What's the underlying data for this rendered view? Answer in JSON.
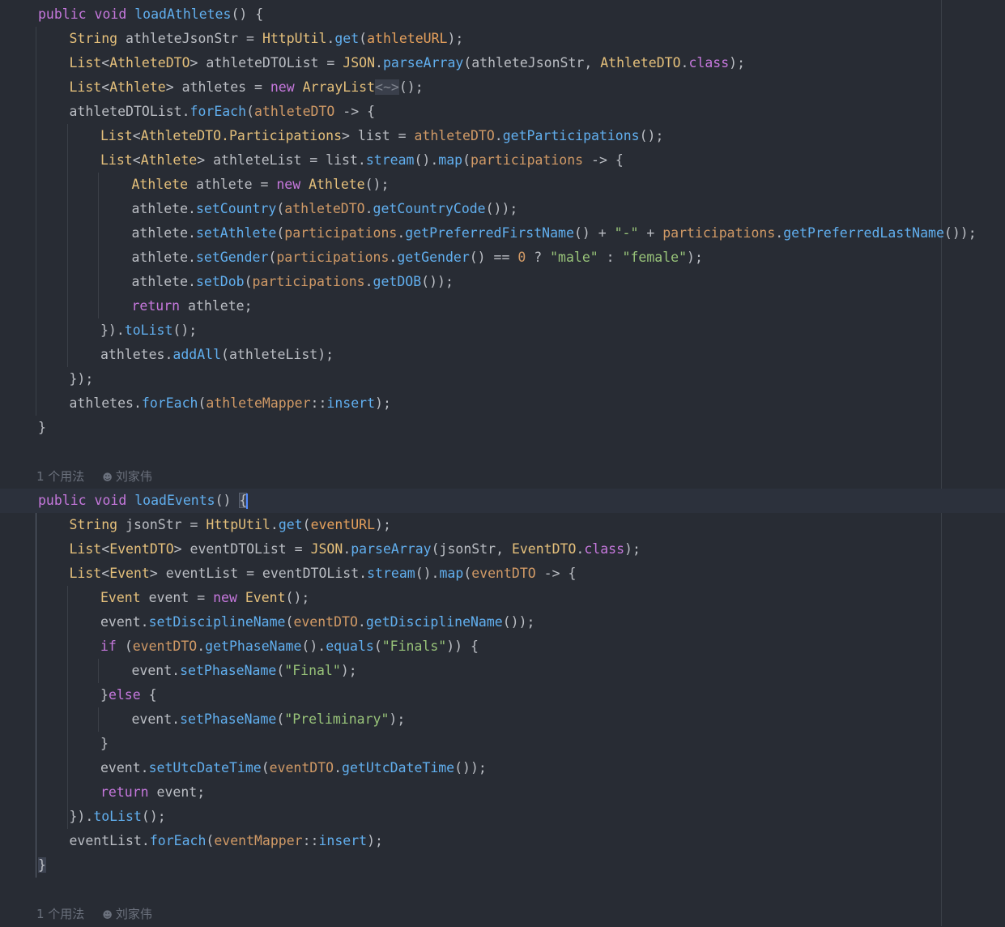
{
  "theme": {
    "background": "#282c34",
    "keyword": "#c678dd",
    "type": "#e5c07b",
    "method": "#61afef",
    "string": "#98c379",
    "field": "#e5a05c"
  },
  "hints": [
    {
      "usages": "1 个用法",
      "author": "刘家伟"
    },
    {
      "usages": "1 个用法",
      "author": "刘家伟"
    }
  ],
  "code": [
    {
      "indent": 0,
      "tokens": [
        [
          "kw",
          "public "
        ],
        [
          "kw",
          "void "
        ],
        [
          "fn",
          "loadAthletes"
        ],
        [
          "pl",
          "() {"
        ]
      ]
    },
    {
      "indent": 1,
      "tokens": [
        [
          "ty",
          "String "
        ],
        [
          "pl",
          "athleteJsonStr = "
        ],
        [
          "ty",
          "HttpUtil"
        ],
        [
          "pl",
          "."
        ],
        [
          "fn",
          "get"
        ],
        [
          "pl",
          "("
        ],
        [
          "fld",
          "athleteURL"
        ],
        [
          "pl",
          ");"
        ]
      ]
    },
    {
      "indent": 1,
      "tokens": [
        [
          "ty",
          "List"
        ],
        [
          "pl",
          "<"
        ],
        [
          "ty",
          "AthleteDTO"
        ],
        [
          "pl",
          "> athleteDTOList = "
        ],
        [
          "ty",
          "JSON"
        ],
        [
          "pl",
          "."
        ],
        [
          "fn",
          "parseArray"
        ],
        [
          "pl",
          "(athleteJsonStr, "
        ],
        [
          "ty",
          "AthleteDTO"
        ],
        [
          "pl",
          "."
        ],
        [
          "cls",
          "class"
        ],
        [
          "pl",
          ");"
        ]
      ]
    },
    {
      "indent": 1,
      "tokens": [
        [
          "ty",
          "List"
        ],
        [
          "pl",
          "<"
        ],
        [
          "ty",
          "Athlete"
        ],
        [
          "pl",
          "> athletes = "
        ],
        [
          "kw",
          "new "
        ],
        [
          "ty",
          "ArrayList"
        ],
        [
          "fold",
          "<~>"
        ],
        [
          "pl",
          "();"
        ]
      ]
    },
    {
      "indent": 1,
      "tokens": [
        [
          "pl",
          "athleteDTOList."
        ],
        [
          "fn",
          "forEach"
        ],
        [
          "pl",
          "("
        ],
        [
          "lam",
          "athleteDTO"
        ],
        [
          "pl",
          " -> {"
        ]
      ]
    },
    {
      "indent": 2,
      "tokens": [
        [
          "ty",
          "List"
        ],
        [
          "pl",
          "<"
        ],
        [
          "ty",
          "AthleteDTO.Participations"
        ],
        [
          "pl",
          "> list = "
        ],
        [
          "lam",
          "athleteDTO"
        ],
        [
          "pl",
          "."
        ],
        [
          "fn",
          "getParticipations"
        ],
        [
          "pl",
          "();"
        ]
      ]
    },
    {
      "indent": 2,
      "tokens": [
        [
          "ty",
          "List"
        ],
        [
          "pl",
          "<"
        ],
        [
          "ty",
          "Athlete"
        ],
        [
          "pl",
          "> athleteList = list."
        ],
        [
          "fn",
          "stream"
        ],
        [
          "pl",
          "()."
        ],
        [
          "fn",
          "map"
        ],
        [
          "pl",
          "("
        ],
        [
          "lam",
          "participations"
        ],
        [
          "pl",
          " -> {"
        ]
      ]
    },
    {
      "indent": 3,
      "tokens": [
        [
          "ty",
          "Athlete "
        ],
        [
          "pl",
          "athlete = "
        ],
        [
          "kw",
          "new "
        ],
        [
          "ty",
          "Athlete"
        ],
        [
          "pl",
          "();"
        ]
      ]
    },
    {
      "indent": 3,
      "tokens": [
        [
          "pl",
          "athlete."
        ],
        [
          "fn",
          "setCountry"
        ],
        [
          "pl",
          "("
        ],
        [
          "lam",
          "athleteDTO"
        ],
        [
          "pl",
          "."
        ],
        [
          "fn",
          "getCountryCode"
        ],
        [
          "pl",
          "());"
        ]
      ]
    },
    {
      "indent": 3,
      "tokens": [
        [
          "pl",
          "athlete."
        ],
        [
          "fn",
          "setAthlete"
        ],
        [
          "pl",
          "("
        ],
        [
          "lam",
          "participations"
        ],
        [
          "pl",
          "."
        ],
        [
          "fn",
          "getPreferredFirstName"
        ],
        [
          "pl",
          "() + "
        ],
        [
          "str",
          "\"-\""
        ],
        [
          "pl",
          " + "
        ],
        [
          "lam",
          "participations"
        ],
        [
          "pl",
          "."
        ],
        [
          "fn",
          "getPreferredLastName"
        ],
        [
          "pl",
          "());"
        ]
      ]
    },
    {
      "indent": 3,
      "tokens": [
        [
          "pl",
          "athlete."
        ],
        [
          "fn",
          "setGender"
        ],
        [
          "pl",
          "("
        ],
        [
          "lam",
          "participations"
        ],
        [
          "pl",
          "."
        ],
        [
          "fn",
          "getGender"
        ],
        [
          "pl",
          "() == "
        ],
        [
          "num",
          "0"
        ],
        [
          "pl",
          " ? "
        ],
        [
          "str",
          "\"male\""
        ],
        [
          "pl",
          " : "
        ],
        [
          "str",
          "\"female\""
        ],
        [
          "pl",
          ");"
        ]
      ]
    },
    {
      "indent": 3,
      "tokens": [
        [
          "pl",
          "athlete."
        ],
        [
          "fn",
          "setDob"
        ],
        [
          "pl",
          "("
        ],
        [
          "lam",
          "participations"
        ],
        [
          "pl",
          "."
        ],
        [
          "fn",
          "getDOB"
        ],
        [
          "pl",
          "());"
        ]
      ]
    },
    {
      "indent": 3,
      "tokens": [
        [
          "kw",
          "return "
        ],
        [
          "pl",
          "athlete;"
        ]
      ]
    },
    {
      "indent": 2,
      "tokens": [
        [
          "pl",
          "})."
        ],
        [
          "fn",
          "toList"
        ],
        [
          "pl",
          "();"
        ]
      ]
    },
    {
      "indent": 2,
      "tokens": [
        [
          "pl",
          "athletes."
        ],
        [
          "fn",
          "addAll"
        ],
        [
          "pl",
          "(athleteList);"
        ]
      ]
    },
    {
      "indent": 1,
      "tokens": [
        [
          "pl",
          "});"
        ]
      ]
    },
    {
      "indent": 1,
      "tokens": [
        [
          "pl",
          "athletes."
        ],
        [
          "fn",
          "forEach"
        ],
        [
          "pl",
          "("
        ],
        [
          "lam",
          "athleteMapper"
        ],
        [
          "pl",
          "::"
        ],
        [
          "fn",
          "insert"
        ],
        [
          "pl",
          ");"
        ]
      ]
    },
    {
      "indent": 0,
      "tokens": [
        [
          "pl",
          "}"
        ]
      ]
    },
    {
      "indent": 0,
      "tokens": []
    },
    {
      "hint": 0
    },
    {
      "indent": 0,
      "active": true,
      "tokens": [
        [
          "kw",
          "public "
        ],
        [
          "kw",
          "void "
        ],
        [
          "fn",
          "loadEvents"
        ],
        [
          "pl",
          "() "
        ],
        [
          "brace-hl",
          "{"
        ]
      ]
    },
    {
      "indent": 1,
      "tokens": [
        [
          "ty",
          "String "
        ],
        [
          "pl",
          "jsonStr = "
        ],
        [
          "ty",
          "HttpUtil"
        ],
        [
          "pl",
          "."
        ],
        [
          "fn",
          "get"
        ],
        [
          "pl",
          "("
        ],
        [
          "fld",
          "eventURL"
        ],
        [
          "pl",
          ");"
        ]
      ]
    },
    {
      "indent": 1,
      "tokens": [
        [
          "ty",
          "List"
        ],
        [
          "pl",
          "<"
        ],
        [
          "ty",
          "EventDTO"
        ],
        [
          "pl",
          "> eventDTOList = "
        ],
        [
          "ty",
          "JSON"
        ],
        [
          "pl",
          "."
        ],
        [
          "fn",
          "parseArray"
        ],
        [
          "pl",
          "(jsonStr, "
        ],
        [
          "ty",
          "EventDTO"
        ],
        [
          "pl",
          "."
        ],
        [
          "cls",
          "class"
        ],
        [
          "pl",
          ");"
        ]
      ]
    },
    {
      "indent": 1,
      "tokens": [
        [
          "ty",
          "List"
        ],
        [
          "pl",
          "<"
        ],
        [
          "ty",
          "Event"
        ],
        [
          "pl",
          "> eventList = eventDTOList."
        ],
        [
          "fn",
          "stream"
        ],
        [
          "pl",
          "()."
        ],
        [
          "fn",
          "map"
        ],
        [
          "pl",
          "("
        ],
        [
          "lam",
          "eventDTO"
        ],
        [
          "pl",
          " -> {"
        ]
      ]
    },
    {
      "indent": 2,
      "tokens": [
        [
          "ty",
          "Event "
        ],
        [
          "pl",
          "event = "
        ],
        [
          "kw",
          "new "
        ],
        [
          "ty",
          "Event"
        ],
        [
          "pl",
          "();"
        ]
      ]
    },
    {
      "indent": 2,
      "tokens": [
        [
          "pl",
          "event."
        ],
        [
          "fn",
          "setDisciplineName"
        ],
        [
          "pl",
          "("
        ],
        [
          "lam",
          "eventDTO"
        ],
        [
          "pl",
          "."
        ],
        [
          "fn",
          "getDisciplineName"
        ],
        [
          "pl",
          "());"
        ]
      ]
    },
    {
      "indent": 2,
      "tokens": [
        [
          "kw",
          "if "
        ],
        [
          "pl",
          "("
        ],
        [
          "lam",
          "eventDTO"
        ],
        [
          "pl",
          "."
        ],
        [
          "fn",
          "getPhaseName"
        ],
        [
          "pl",
          "()."
        ],
        [
          "fn",
          "equals"
        ],
        [
          "pl",
          "("
        ],
        [
          "str",
          "\"Finals\""
        ],
        [
          "pl",
          ")) {"
        ]
      ]
    },
    {
      "indent": 3,
      "tokens": [
        [
          "pl",
          "event."
        ],
        [
          "fn",
          "setPhaseName"
        ],
        [
          "pl",
          "("
        ],
        [
          "str",
          "\"Final\""
        ],
        [
          "pl",
          ");"
        ]
      ]
    },
    {
      "indent": 2,
      "tokens": [
        [
          "pl",
          "}"
        ],
        [
          "kw",
          "else "
        ],
        [
          "pl",
          "{"
        ]
      ]
    },
    {
      "indent": 3,
      "tokens": [
        [
          "pl",
          "event."
        ],
        [
          "fn",
          "setPhaseName"
        ],
        [
          "pl",
          "("
        ],
        [
          "str",
          "\"Preliminary\""
        ],
        [
          "pl",
          ");"
        ]
      ]
    },
    {
      "indent": 2,
      "tokens": [
        [
          "pl",
          "}"
        ]
      ]
    },
    {
      "indent": 2,
      "tokens": [
        [
          "pl",
          "event."
        ],
        [
          "fn",
          "setUtcDateTime"
        ],
        [
          "pl",
          "("
        ],
        [
          "lam",
          "eventDTO"
        ],
        [
          "pl",
          "."
        ],
        [
          "fn",
          "getUtcDateTime"
        ],
        [
          "pl",
          "());"
        ]
      ]
    },
    {
      "indent": 2,
      "tokens": [
        [
          "kw",
          "return "
        ],
        [
          "pl",
          "event;"
        ]
      ]
    },
    {
      "indent": 1,
      "tokens": [
        [
          "pl",
          "})."
        ],
        [
          "fn",
          "toList"
        ],
        [
          "pl",
          "();"
        ]
      ]
    },
    {
      "indent": 1,
      "tokens": [
        [
          "pl",
          "eventList."
        ],
        [
          "fn",
          "forEach"
        ],
        [
          "pl",
          "("
        ],
        [
          "lam",
          "eventMapper"
        ],
        [
          "pl",
          "::"
        ],
        [
          "fn",
          "insert"
        ],
        [
          "pl",
          ");"
        ]
      ]
    },
    {
      "indent": 0,
      "tokens": [
        [
          "brace-end",
          "}"
        ]
      ]
    },
    {
      "indent": 0,
      "tokens": []
    },
    {
      "hint": 1
    }
  ]
}
